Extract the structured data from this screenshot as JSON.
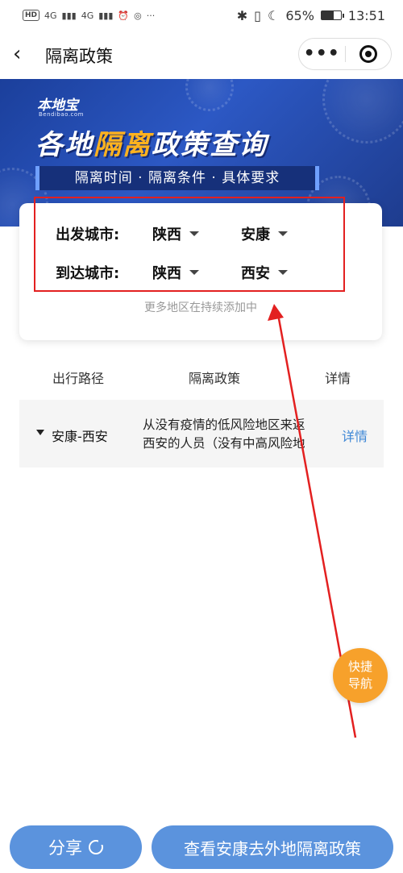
{
  "status_bar": {
    "left_tags": [
      "HD",
      "4G",
      "4G"
    ],
    "battery": "65%",
    "battery_level": 0.65,
    "time": "13:51",
    "icons": [
      "bluetooth-icon",
      "vibrate-icon",
      "moon-icon",
      "battery-icon"
    ]
  },
  "nav": {
    "title": "隔离政策",
    "back_icon": "chevron-left-icon",
    "more_icon": "more-dots-icon",
    "close_icon": "target-close-icon"
  },
  "banner": {
    "logo": "本地宝",
    "logo_sub": "Bendibao.com",
    "title_before": "各地",
    "title_highlight": "隔离",
    "title_after": "政策查询",
    "strip": "隔离时间 · 隔离条件 · 具体要求"
  },
  "selector": {
    "depart_label": "出发城市:",
    "depart_province": "陕西",
    "depart_city": "安康",
    "arrive_label": "到达城市:",
    "arrive_province": "陕西",
    "arrive_city": "西安",
    "hint": "更多地区在持续添加中"
  },
  "table": {
    "headers": [
      "出行路径",
      "隔离政策",
      "详情"
    ],
    "rows": [
      {
        "route": "安康-西安",
        "policy": "从没有疫情的低风险地区来返西安的人员（没有中高风险地区旅居史）",
        "detail": "详情"
      }
    ]
  },
  "fab": {
    "line1": "快捷",
    "line2": "导航"
  },
  "buttons": {
    "share": "分享",
    "main": "查看安康去外地隔离政策"
  },
  "colors": {
    "primary": "#5b93dd",
    "banner": "#2c58c4",
    "highlight": "#ffb21f",
    "fab": "#f7a12b",
    "annotation": "#e32020",
    "link": "#3f88d6"
  }
}
